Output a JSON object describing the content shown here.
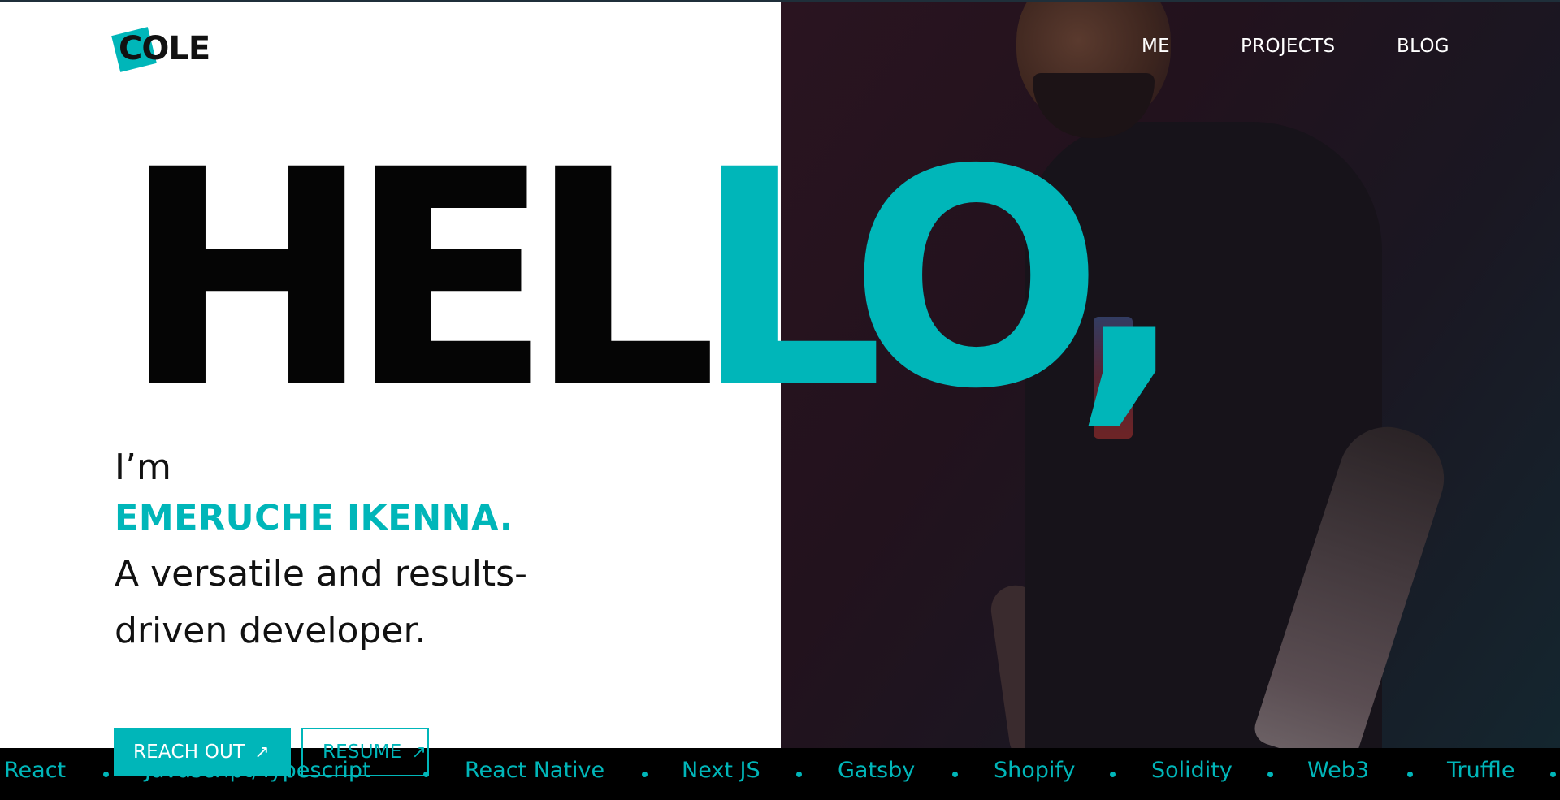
{
  "logo": {
    "text": "COLE"
  },
  "nav": {
    "items": [
      {
        "label": "ME"
      },
      {
        "label": "PROJECTS"
      },
      {
        "label": "BLOG"
      }
    ]
  },
  "hero": {
    "hello_dark": "HEL",
    "hello_teal": "LO,",
    "intro_prefix": "I’m",
    "name": "EMERUCHE IKENNA.",
    "tagline": "A versatile and results-driven developer."
  },
  "buttons": {
    "reach_out": "REACH OUT",
    "resume": "RESUME",
    "arrow_glyph": "↗"
  },
  "ticker": {
    "items": [
      "React",
      "Javascript/Typescript",
      "React Native",
      "Next JS",
      "Gatsby",
      "Shopify",
      "Solidity",
      "Web3",
      "Truffle"
    ]
  },
  "colors": {
    "accent": "#00b6b9",
    "text_dark": "#111111",
    "ticker_bg": "#000000",
    "nav_text": "#ffffff"
  }
}
